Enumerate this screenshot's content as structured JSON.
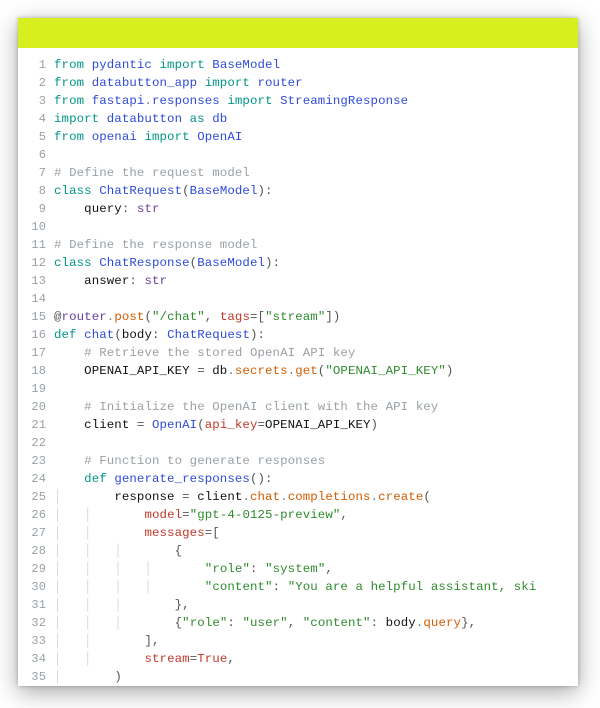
{
  "accent_color": "#d7ef1e",
  "language": "python",
  "lines": [
    {
      "n": 1,
      "indent": 0,
      "guides": 0,
      "tokens": [
        [
          "kw",
          "from "
        ],
        [
          "mod",
          "pydantic"
        ],
        [
          "kw",
          " import "
        ],
        [
          "cls",
          "BaseModel"
        ]
      ]
    },
    {
      "n": 2,
      "indent": 0,
      "guides": 0,
      "tokens": [
        [
          "kw",
          "from "
        ],
        [
          "mod",
          "databutton_app"
        ],
        [
          "kw",
          " import "
        ],
        [
          "mod",
          "router"
        ]
      ]
    },
    {
      "n": 3,
      "indent": 0,
      "guides": 0,
      "tokens": [
        [
          "kw",
          "from "
        ],
        [
          "mod",
          "fastapi"
        ],
        [
          "dot",
          "."
        ],
        [
          "mod",
          "responses"
        ],
        [
          "kw",
          " import "
        ],
        [
          "cls",
          "StreamingResponse"
        ]
      ]
    },
    {
      "n": 4,
      "indent": 0,
      "guides": 0,
      "tokens": [
        [
          "kw",
          "import "
        ],
        [
          "mod",
          "databutton"
        ],
        [
          "kw",
          " as "
        ],
        [
          "mod",
          "db"
        ]
      ]
    },
    {
      "n": 5,
      "indent": 0,
      "guides": 0,
      "tokens": [
        [
          "kw",
          "from "
        ],
        [
          "mod",
          "openai"
        ],
        [
          "kw",
          " import "
        ],
        [
          "cls",
          "OpenAI"
        ]
      ]
    },
    {
      "n": 6,
      "indent": 0,
      "guides": 0,
      "tokens": []
    },
    {
      "n": 7,
      "indent": 0,
      "guides": 0,
      "tokens": [
        [
          "cmt",
          "# Define the request model"
        ]
      ]
    },
    {
      "n": 8,
      "indent": 0,
      "guides": 0,
      "tokens": [
        [
          "kw",
          "class "
        ],
        [
          "cls",
          "ChatRequest"
        ],
        [
          "punct",
          "("
        ],
        [
          "cls",
          "BaseModel"
        ],
        [
          "punct",
          "):"
        ]
      ]
    },
    {
      "n": 9,
      "indent": 1,
      "guides": 0,
      "tokens": [
        [
          "plain",
          "query"
        ],
        [
          "punct",
          ": "
        ],
        [
          "type",
          "str"
        ]
      ]
    },
    {
      "n": 10,
      "indent": 0,
      "guides": 0,
      "tokens": []
    },
    {
      "n": 11,
      "indent": 0,
      "guides": 0,
      "tokens": [
        [
          "cmt",
          "# Define the response model"
        ]
      ]
    },
    {
      "n": 12,
      "indent": 0,
      "guides": 0,
      "tokens": [
        [
          "kw",
          "class "
        ],
        [
          "cls",
          "ChatResponse"
        ],
        [
          "punct",
          "("
        ],
        [
          "cls",
          "BaseModel"
        ],
        [
          "punct",
          "):"
        ]
      ]
    },
    {
      "n": 13,
      "indent": 1,
      "guides": 0,
      "tokens": [
        [
          "plain",
          "answer"
        ],
        [
          "punct",
          ": "
        ],
        [
          "type",
          "str"
        ]
      ]
    },
    {
      "n": 14,
      "indent": 0,
      "guides": 0,
      "tokens": []
    },
    {
      "n": 15,
      "indent": 0,
      "guides": 0,
      "tokens": [
        [
          "punct",
          "@"
        ],
        [
          "ann",
          "router"
        ],
        [
          "dot",
          "."
        ],
        [
          "attr",
          "post"
        ],
        [
          "punct",
          "("
        ],
        [
          "str",
          "\"/chat\""
        ],
        [
          "punct",
          ", "
        ],
        [
          "param",
          "tags"
        ],
        [
          "punct",
          "=["
        ],
        [
          "str",
          "\"stream\""
        ],
        [
          "punct",
          "])"
        ]
      ]
    },
    {
      "n": 16,
      "indent": 0,
      "guides": 0,
      "tokens": [
        [
          "kw",
          "def "
        ],
        [
          "fn",
          "chat"
        ],
        [
          "punct",
          "("
        ],
        [
          "plain",
          "body"
        ],
        [
          "punct",
          ": "
        ],
        [
          "cls",
          "ChatRequest"
        ],
        [
          "punct",
          "):"
        ]
      ]
    },
    {
      "n": 17,
      "indent": 1,
      "guides": 0,
      "tokens": [
        [
          "cmt",
          "# Retrieve the stored OpenAI API key"
        ]
      ]
    },
    {
      "n": 18,
      "indent": 1,
      "guides": 0,
      "tokens": [
        [
          "plain",
          "OPENAI_API_KEY"
        ],
        [
          "punct",
          " = "
        ],
        [
          "plain",
          "db"
        ],
        [
          "dot",
          "."
        ],
        [
          "attr",
          "secrets"
        ],
        [
          "dot",
          "."
        ],
        [
          "attr",
          "get"
        ],
        [
          "punct",
          "("
        ],
        [
          "str",
          "\"OPENAI_API_KEY\""
        ],
        [
          "punct",
          ")"
        ]
      ]
    },
    {
      "n": 19,
      "indent": 0,
      "guides": 0,
      "tokens": []
    },
    {
      "n": 20,
      "indent": 1,
      "guides": 0,
      "tokens": [
        [
          "cmt",
          "# Initialize the OpenAI client with the API key"
        ]
      ]
    },
    {
      "n": 21,
      "indent": 1,
      "guides": 0,
      "tokens": [
        [
          "plain",
          "client"
        ],
        [
          "punct",
          " = "
        ],
        [
          "cls",
          "OpenAI"
        ],
        [
          "punct",
          "("
        ],
        [
          "param",
          "api_key"
        ],
        [
          "punct",
          "="
        ],
        [
          "plain",
          "OPENAI_API_KEY"
        ],
        [
          "punct",
          ")"
        ]
      ]
    },
    {
      "n": 22,
      "indent": 0,
      "guides": 0,
      "tokens": []
    },
    {
      "n": 23,
      "indent": 1,
      "guides": 0,
      "tokens": [
        [
          "cmt",
          "# Function to generate responses"
        ]
      ]
    },
    {
      "n": 24,
      "indent": 1,
      "guides": 0,
      "tokens": [
        [
          "kw",
          "def "
        ],
        [
          "fn",
          "generate_responses"
        ],
        [
          "punct",
          "():"
        ]
      ]
    },
    {
      "n": 25,
      "indent": 2,
      "guides": 1,
      "tokens": [
        [
          "plain",
          "response"
        ],
        [
          "punct",
          " = "
        ],
        [
          "plain",
          "client"
        ],
        [
          "dot",
          "."
        ],
        [
          "attr",
          "chat"
        ],
        [
          "dot",
          "."
        ],
        [
          "attr",
          "completions"
        ],
        [
          "dot",
          "."
        ],
        [
          "attr",
          "create"
        ],
        [
          "punct",
          "("
        ]
      ]
    },
    {
      "n": 26,
      "indent": 3,
      "guides": 2,
      "tokens": [
        [
          "param",
          "model"
        ],
        [
          "punct",
          "="
        ],
        [
          "str",
          "\"gpt-4-0125-preview\""
        ],
        [
          "punct",
          ","
        ]
      ]
    },
    {
      "n": 27,
      "indent": 3,
      "guides": 2,
      "tokens": [
        [
          "param",
          "messages"
        ],
        [
          "punct",
          "=["
        ]
      ]
    },
    {
      "n": 28,
      "indent": 4,
      "guides": 3,
      "tokens": [
        [
          "punct",
          "{"
        ]
      ]
    },
    {
      "n": 29,
      "indent": 5,
      "guides": 4,
      "tokens": [
        [
          "str",
          "\"role\""
        ],
        [
          "punct",
          ": "
        ],
        [
          "str",
          "\"system\""
        ],
        [
          "punct",
          ","
        ]
      ]
    },
    {
      "n": 30,
      "indent": 5,
      "guides": 4,
      "tokens": [
        [
          "str",
          "\"content\""
        ],
        [
          "punct",
          ": "
        ],
        [
          "str",
          "\"You are a helpful assistant, ski"
        ]
      ]
    },
    {
      "n": 31,
      "indent": 4,
      "guides": 3,
      "tokens": [
        [
          "punct",
          "},"
        ]
      ]
    },
    {
      "n": 32,
      "indent": 4,
      "guides": 3,
      "tokens": [
        [
          "punct",
          "{"
        ],
        [
          "str",
          "\"role\""
        ],
        [
          "punct",
          ": "
        ],
        [
          "str",
          "\"user\""
        ],
        [
          "punct",
          ", "
        ],
        [
          "str",
          "\"content\""
        ],
        [
          "punct",
          ": "
        ],
        [
          "plain",
          "body"
        ],
        [
          "dot",
          "."
        ],
        [
          "attr",
          "query"
        ],
        [
          "punct",
          "},"
        ]
      ]
    },
    {
      "n": 33,
      "indent": 3,
      "guides": 2,
      "tokens": [
        [
          "punct",
          "],"
        ]
      ]
    },
    {
      "n": 34,
      "indent": 3,
      "guides": 2,
      "tokens": [
        [
          "param",
          "stream"
        ],
        [
          "punct",
          "="
        ],
        [
          "bool",
          "True"
        ],
        [
          "punct",
          ","
        ]
      ]
    },
    {
      "n": 35,
      "indent": 2,
      "guides": 1,
      "tokens": [
        [
          "punct",
          ")"
        ]
      ]
    }
  ]
}
